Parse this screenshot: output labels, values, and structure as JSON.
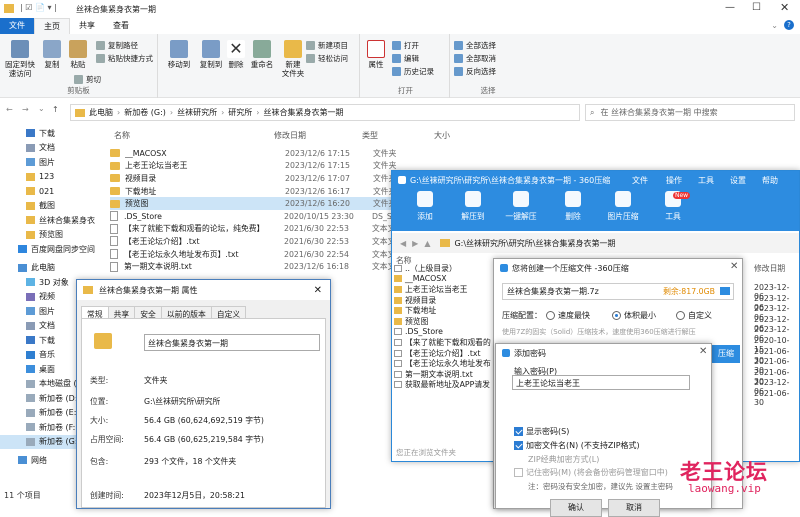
{
  "explorer": {
    "title": "丝袜合集紧身衣第一期",
    "tabs": [
      "文件",
      "主页",
      "共享",
      "查看"
    ],
    "ribbon": {
      "pin": "固定到快\n速访问",
      "copy": "复制",
      "paste": "粘贴",
      "copy_path": "复制路径",
      "paste_shortcut": "粘贴快捷方式",
      "cut": "剪切",
      "clipboard": "剪贴板",
      "move_to": "移动到",
      "copy_to": "复制到",
      "delete": "删除",
      "rename": "重命名",
      "new_folder": "新建\n文件夹",
      "new_item": "新建项目",
      "easy_access": "轻松访问",
      "properties": "属性",
      "open": "打开",
      "edit": "编辑",
      "history": "历史记录",
      "open_group": "打开",
      "select_all": "全部选择",
      "select_none": "全部取消",
      "invert": "反向选择",
      "select_group": "选择"
    },
    "breadcrumb": [
      "此电脑",
      "新加卷 (G:)",
      "丝袜研究所",
      "研究所",
      "丝袜合集紧身衣第一期"
    ],
    "search_placeholder": "在 丝袜合集紧身衣第一期 中搜索",
    "nav": [
      "下载",
      "文档",
      "图片",
      "123",
      "021",
      "截图",
      "丝袜合集紧身衣",
      "预览图",
      "百度网盘同步空间",
      "此电脑",
      "3D 对象",
      "视频",
      "图片",
      "文档",
      "下载",
      "音乐",
      "桌面",
      "本地磁盘 (C:)",
      "新加卷 (D:)",
      "新加卷 (E:)",
      "新加卷 (F:)",
      "新加卷 (G:)",
      "网络"
    ],
    "columns": {
      "name": "名称",
      "date": "修改日期",
      "type": "类型",
      "size": "大小"
    },
    "files": [
      {
        "name": "__MACOSX",
        "date": "2023/12/6 17:15",
        "type": "文件夹",
        "kind": "folder"
      },
      {
        "name": "上老王论坛当老王",
        "date": "2023/12/6 17:15",
        "type": "文件夹",
        "kind": "folder"
      },
      {
        "name": "视频目录",
        "date": "2023/12/6 17:07",
        "type": "文件夹",
        "kind": "folder"
      },
      {
        "name": "下载地址",
        "date": "2023/12/6 16:17",
        "type": "文件夹",
        "kind": "folder"
      },
      {
        "name": "预览图",
        "date": "2023/12/6 16:20",
        "type": "文件夹",
        "kind": "folder"
      },
      {
        "name": ".DS_Store",
        "date": "2020/10/15 23:30",
        "type": "DS_STOR",
        "kind": "doc"
      },
      {
        "name": "【来了就能下载和观看的论坛，纯免费】",
        "date": "2021/6/30 22:53",
        "type": "文本文档",
        "kind": "doc"
      },
      {
        "name": "【老王论坛介绍】.txt",
        "date": "2021/6/30 22:53",
        "type": "文本文档",
        "kind": "doc"
      },
      {
        "name": "【老王论坛永久地址发布页】.txt",
        "date": "2021/6/30 22:54",
        "type": "文本文档",
        "kind": "doc"
      },
      {
        "name": "第一期文本说明.txt",
        "date": "2023/12/6 16:18",
        "type": "文本文档",
        "kind": "doc"
      }
    ],
    "status": "11 个项目"
  },
  "props": {
    "title": "丝袜合集紧身衣第一期 属性",
    "tabs": [
      "常规",
      "共享",
      "安全",
      "以前的版本",
      "自定义"
    ],
    "name": "丝袜合集紧身衣第一期",
    "rows": [
      {
        "k": "类型:",
        "v": "文件夹"
      },
      {
        "k": "位置:",
        "v": "G:\\丝袜研究所\\研究所"
      },
      {
        "k": "大小:",
        "v": "56.4 GB (60,624,692,519 字节)"
      },
      {
        "k": "占用空间:",
        "v": "56.4 GB (60,625,219,584 字节)"
      },
      {
        "k": "包含:",
        "v": "293 个文件，18 个文件夹"
      },
      {
        "k": "创建时间:",
        "v": "2023年12月5日，20:58:21"
      }
    ]
  },
  "z360": {
    "title": "G:\\丝袜研究所\\研究所\\丝袜合集紧身衣第一期 - 360压缩",
    "menu": [
      "文件",
      "操作",
      "工具",
      "设置",
      "帮助"
    ],
    "tools": [
      "添加",
      "解压到",
      "一键解压",
      "删除",
      "图片压缩",
      "工具"
    ],
    "new_badge": "New",
    "path": "G:\\丝袜研究所\\研究所\\丝袜合集紧身衣第一期",
    "list_header": "名称",
    "list": [
      "..（上级目录）",
      "__MACOSX",
      "上老王论坛当老王",
      "视频目录",
      "下载地址",
      "预览图",
      ".DS_Store",
      "【来了就能下载和观看的",
      "【老王论坛介绍】.txt",
      "【老王论坛永久地址发布",
      "第一期文本说明.txt",
      "获取最新地址及APP请发"
    ],
    "date_header": "修改日期",
    "dates": [
      "2023-12-06",
      "2023-12-06",
      "2023-12-06",
      "2023-12-06",
      "2023-12-06",
      "2020-10-15",
      "2021-06-30",
      "2021-06-30",
      "2021-06-30",
      "2023-12-06",
      "2021-06-30"
    ],
    "footer": "您正在浏览文件夹"
  },
  "create": {
    "title": "您将创建一个压缩文件 -360压缩",
    "filename": "丝袜合集紧身衣第一期.7z",
    "remaining": "剩余:817.0GB",
    "config_label": "压缩配置：",
    "opt_fast": "速度最快",
    "opt_small": "体积最小",
    "opt_custom": "自定义",
    "desc": "使用7Z的固实（Solid）压缩技术，速度使用360压缩进行解压",
    "start_btn": "压缩"
  },
  "pwd": {
    "title": "添加密码",
    "label": "输入密码(P)",
    "value": "上老王论坛当老王",
    "show": "显示密码(S)",
    "encrypt_names": "加密文件名(N) (不支持ZIP格式)",
    "zip_legacy": "ZIP经典加密方式(L)",
    "remember": "记住密码(M) (将会备份密码管理窗口中)",
    "note": "注：密码没有安全加密，建议先 设置主密码",
    "ok": "确认",
    "cancel": "取消"
  },
  "watermark": {
    "text": "老王论坛",
    "url": "laowang.vip"
  }
}
